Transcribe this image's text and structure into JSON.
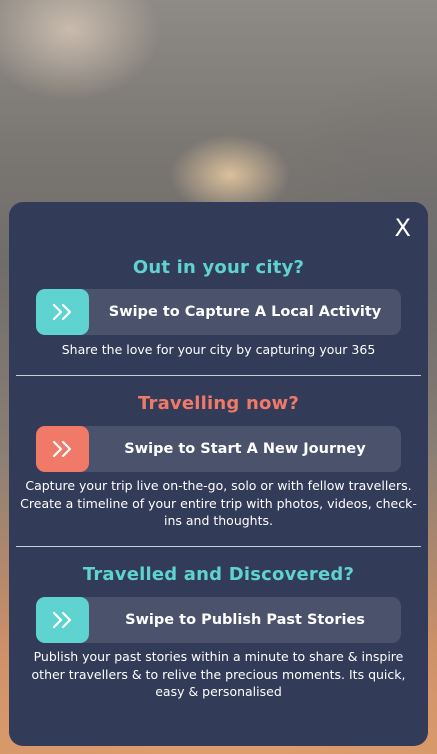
{
  "modal": {
    "close_label": "X"
  },
  "sections": [
    {
      "title": "Out in your city?",
      "swipe_label": "Swipe to Capture A Local Activity",
      "description": "Share the love for your city by capturing your 365"
    },
    {
      "title": "Travelling now?",
      "swipe_label": "Swipe to Start A New Journey",
      "description": "Capture your trip live on-the-go, solo or with fellow travellers. Create a timeline of your entire trip with photos, videos, check-ins and thoughts."
    },
    {
      "title": "Travelled and Discovered?",
      "swipe_label": "Swipe to Publish Past Stories",
      "description": "Publish your past stories within a minute to share & inspire other travellers & to relive the precious moments. Its quick, easy & personalised"
    }
  ],
  "colors": {
    "modal_bg": "#323b58",
    "teal_accent": "#5fd3cf",
    "coral_accent": "#f07a67",
    "swipe_track": "#4a526c"
  },
  "icons": {
    "swipe_handle": "double-chevron-right-icon",
    "close": "close-icon"
  }
}
